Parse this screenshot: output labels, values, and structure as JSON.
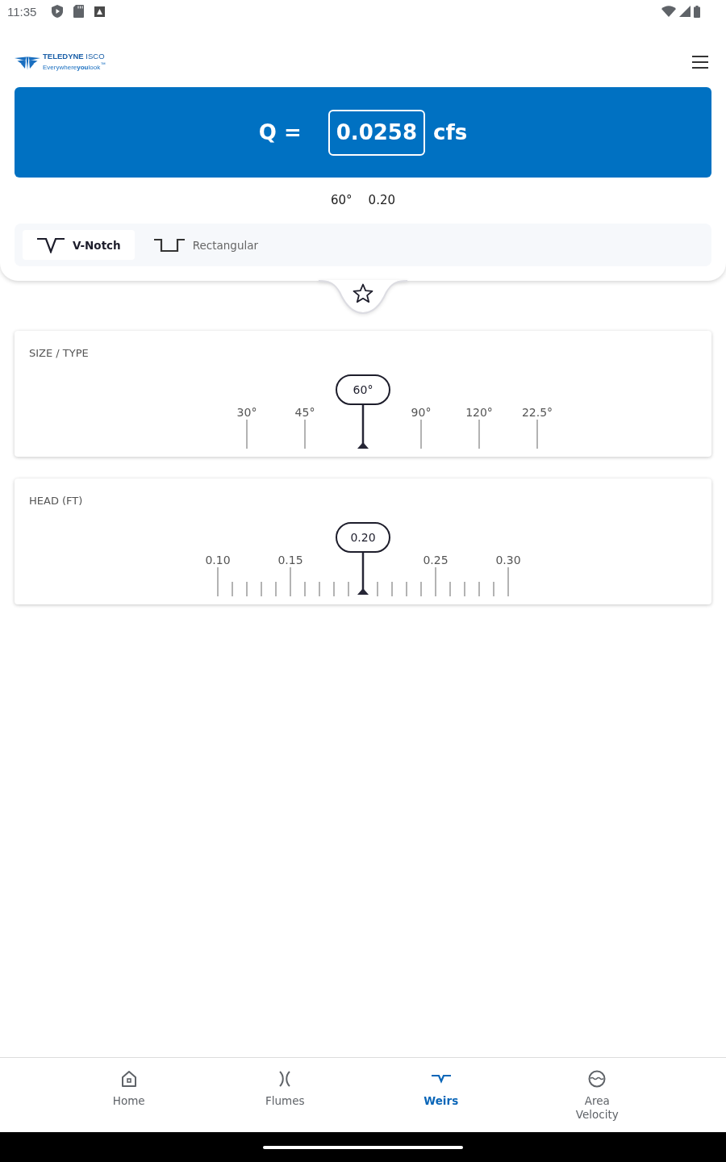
{
  "status_bar": {
    "time": "11:35"
  },
  "header": {
    "brand_name": "**TELEDYNE** ISCO",
    "tagline": "Everywhere**you**look$^{™}$"
  },
  "result": {
    "symbol": "Q =",
    "value": "0.0258",
    "unit": "cfs"
  },
  "summary": [
    "60°",
    "0.20"
  ],
  "weir_types": [
    {
      "label": "V-Notch",
      "kind": "v-notch",
      "selected": true
    },
    {
      "label": "Rectangular",
      "kind": "rectangular",
      "selected": false
    }
  ],
  "favorite": {
    "on": false
  },
  "size_type": {
    "title": "SIZE / TYPE",
    "options": [
      {
        "label": "30°",
        "selected": false
      },
      {
        "label": "45°",
        "selected": false
      },
      {
        "label": "60°",
        "selected": true
      },
      {
        "label": "90°",
        "selected": false
      },
      {
        "label": "120°",
        "selected": false
      },
      {
        "label": "22.5°",
        "selected": false
      }
    ]
  },
  "head": {
    "title": "HEAD (FT)",
    "ticks": [
      {
        "label": "0.10",
        "selected": false
      },
      {
        "label": "0.15",
        "selected": false
      },
      {
        "label": "0.20",
        "selected": true
      },
      {
        "label": "0.25",
        "selected": false
      },
      {
        "label": "0.30",
        "selected": false
      }
    ]
  },
  "bottom_nav": [
    {
      "label": "Home",
      "kind": "home",
      "selected": false
    },
    {
      "label": "Flumes",
      "kind": "flumes",
      "selected": false
    },
    {
      "label": "Weirs",
      "kind": "weirs",
      "selected": true
    },
    {
      "label": "Area Velocity",
      "kind": "area-velocity",
      "selected": false
    }
  ]
}
